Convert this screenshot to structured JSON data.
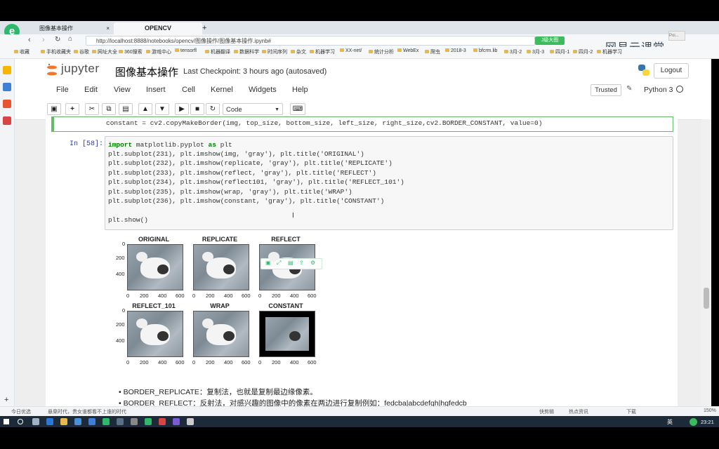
{
  "browser": {
    "tabs": [
      {
        "label": "图像基本操作"
      },
      {
        "label": "OPENCV"
      }
    ],
    "url": "http://localhost:8888/notebooks/opencv/图像操作/图像基本操作.ipynb#",
    "bookmarks": [
      "收藏",
      "手机收藏夹",
      "谷歌",
      "网址大全",
      "360搜索",
      "游戏中心",
      "tensorfl",
      "机器翻译",
      "数据科学",
      "时间序列",
      "杂文",
      "机器学习",
      "XX-net/",
      "统计分析",
      "WebEx",
      "爬虫",
      "2018-3",
      "bfcrm.lib",
      "3月-2",
      "3月-3",
      "四月-1",
      "四月-2",
      "机器学习"
    ],
    "right_tag": "J级大图",
    "watermark": "网易云课堂",
    "overlay_label": "Poi..."
  },
  "jupyter": {
    "logo_text": "jupyter",
    "notebook_title": "图像基本操作",
    "checkpoint": "Last Checkpoint: 3 hours ago (autosaved)",
    "logout": "Logout",
    "menu": [
      "File",
      "Edit",
      "View",
      "Insert",
      "Cell",
      "Kernel",
      "Widgets",
      "Help"
    ],
    "trusted": "Trusted",
    "kernel": "Python 3",
    "celltype": "Code"
  },
  "cells": {
    "prev_line": "constant = cv2.copyMakeBorder(img, top_size, bottom_size, left_size, right_size,cv2.BORDER_CONSTANT, value=0)",
    "prompt": "In [58]:",
    "code_kw_import": "import",
    "code_kw_as": "as",
    "code_line1": " matplotlib.pyplot ",
    "code_line1_end": " plt",
    "code_lines": [
      "plt.subplot(231), plt.imshow(img, 'gray'), plt.title('ORIGINAL')",
      "plt.subplot(232), plt.imshow(replicate, 'gray'), plt.title('REPLICATE')",
      "plt.subplot(233), plt.imshow(reflect, 'gray'), plt.title('REFLECT')",
      "plt.subplot(234), plt.imshow(reflect101, 'gray'), plt.title('REFLECT_101')",
      "plt.subplot(235), plt.imshow(wrap, 'gray'), plt.title('WRAP')",
      "plt.subplot(236), plt.imshow(constant, 'gray'), plt.title('CONSTANT')",
      "",
      "plt.show()"
    ]
  },
  "figure": {
    "titles": [
      "ORIGINAL",
      "REPLICATE",
      "REFLECT",
      "REFLECT_101",
      "WRAP",
      "CONSTANT"
    ],
    "xticks": [
      "0",
      "200",
      "400",
      "600"
    ],
    "yticks": [
      "0",
      "200",
      "400"
    ]
  },
  "markdown": {
    "bullet1": "BORDER_REPLICATE：复制法，也就是复制最边缘像素。",
    "bullet2": "BORDER_REFLECT：反射法，对感兴趣的图像中的像素在两边进行复制例如：fedcba|abcdefgh|hgfedcb"
  },
  "statusbar": {
    "left1": "今日优选",
    "left2": "悬臬时代，贵女谁都看不上谁的时代",
    "right1": "快剪辑",
    "right2": "热点资讯",
    "right3": "下载",
    "zoom": "150%"
  },
  "taskbar": {
    "time": "23:21",
    "lang": "英"
  }
}
